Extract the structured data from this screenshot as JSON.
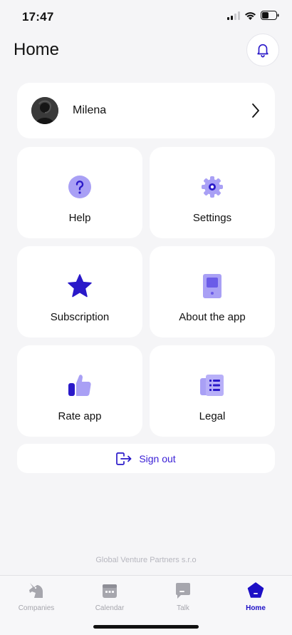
{
  "status": {
    "time": "17:47"
  },
  "header": {
    "title": "Home"
  },
  "profile": {
    "name": "Milena"
  },
  "tiles": [
    {
      "label": "Help",
      "icon": "help-icon"
    },
    {
      "label": "Settings",
      "icon": "gear-icon"
    },
    {
      "label": "Subscription",
      "icon": "star-icon"
    },
    {
      "label": "About the app",
      "icon": "tablet-icon"
    },
    {
      "label": "Rate app",
      "icon": "thumbs-up-icon"
    },
    {
      "label": "Legal",
      "icon": "document-icon"
    }
  ],
  "signout": {
    "label": "Sign out"
  },
  "footer": {
    "company": "Global Venture Partners s.r.o"
  },
  "tabbar": {
    "items": [
      {
        "label": "Companies",
        "icon": "unicorn-icon",
        "active": false
      },
      {
        "label": "Calendar",
        "icon": "calendar-icon",
        "active": false
      },
      {
        "label": "Talk",
        "icon": "chat-icon",
        "active": false
      },
      {
        "label": "Home",
        "icon": "home-icon",
        "active": true
      }
    ]
  },
  "colors": {
    "accent": "#3b20d6",
    "accent_light": "#a9a0f5",
    "background": "#f5f5f7",
    "card": "#ffffff"
  }
}
